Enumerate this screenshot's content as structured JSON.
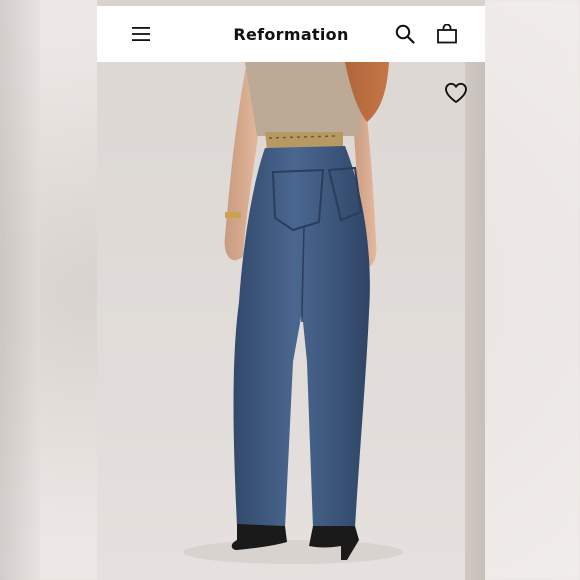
{
  "header": {
    "brand": "Reformation",
    "menu_icon": "hamburger-menu-icon",
    "search_icon": "search-icon",
    "bag_icon": "shopping-bag-icon"
  },
  "product": {
    "wishlist_icon": "heart-outline-icon"
  },
  "colors": {
    "header_bg": "#ffffff",
    "brand_text": "#111111",
    "photo_bg": "#ddd8d4",
    "denim": "#3f5c83"
  }
}
